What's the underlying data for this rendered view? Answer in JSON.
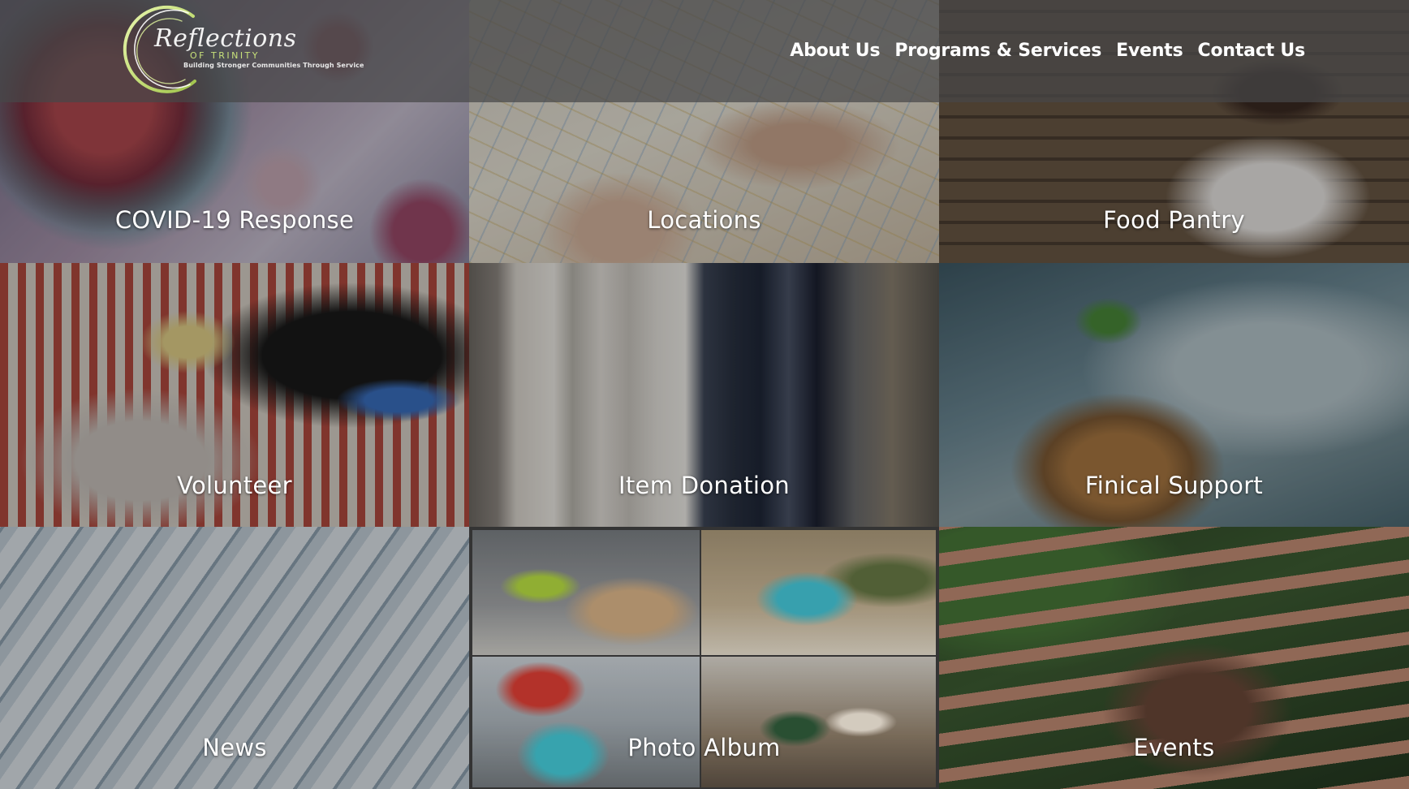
{
  "header": {
    "logo": {
      "script": "Reflections",
      "sub": "OF TRINITY",
      "tagline": "Building Stronger Communities Through Service"
    },
    "nav": [
      {
        "label": "About Us"
      },
      {
        "label": "Programs & Services"
      },
      {
        "label": "Events"
      },
      {
        "label": "Contact Us"
      }
    ]
  },
  "tiles": [
    {
      "label": "COVID-19 Response"
    },
    {
      "label": "Locations"
    },
    {
      "label": "Food Pantry"
    },
    {
      "label": "Volunteer"
    },
    {
      "label": "Item Donation"
    },
    {
      "label": "Finical Support"
    },
    {
      "label": "News"
    },
    {
      "label": "Photo Album"
    },
    {
      "label": "Events"
    }
  ],
  "colors": {
    "logo_ring_green": "#c6e07a",
    "logo_ring_white": "#ffffff",
    "header_overlay": "#464648"
  }
}
